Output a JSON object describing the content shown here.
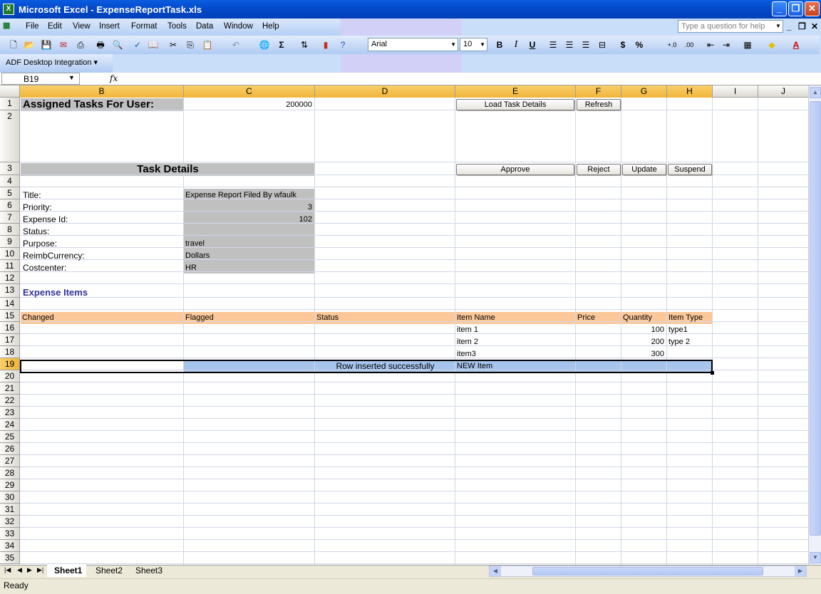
{
  "window": {
    "title": "Microsoft Excel - ExpenseReportTask.xls"
  },
  "menu": {
    "items": [
      {
        "key": "F",
        "rest": "ile"
      },
      {
        "key": "E",
        "rest": "dit"
      },
      {
        "key": "V",
        "rest": "iew"
      },
      {
        "key": "I",
        "rest": "nsert"
      },
      {
        "key": "F",
        "rest": "ormat",
        "pre": ""
      },
      {
        "key": "T",
        "rest": "ools"
      },
      {
        "key": "D",
        "rest": "ata"
      },
      {
        "key": "W",
        "rest": "indow"
      },
      {
        "key": "H",
        "rest": "elp"
      }
    ],
    "labels": [
      "File",
      "Edit",
      "View",
      "Insert",
      "Format",
      "Tools",
      "Data",
      "Window",
      "Help"
    ],
    "help_placeholder": "Type a question for help"
  },
  "toolbar": {
    "font": "Arial",
    "font_size": "10",
    "bold": "B",
    "italic": "I",
    "underline": "U",
    "currency": "$",
    "percent": "%",
    "sigma": "Σ",
    "adf_menu": "ADF Desktop Integration"
  },
  "formula_bar": {
    "name_box": "B19",
    "fx": "fx",
    "content": ""
  },
  "columns": [
    "B",
    "C",
    "D",
    "E",
    "F",
    "G",
    "H",
    "I",
    "J"
  ],
  "rows": [
    "1",
    "2",
    "3",
    "4",
    "5",
    "6",
    "7",
    "8",
    "9",
    "10",
    "11",
    "12",
    "13",
    "14",
    "15",
    "16",
    "17",
    "18",
    "19",
    "20",
    "21",
    "22",
    "23",
    "24",
    "25",
    "26",
    "27",
    "28",
    "29",
    "30",
    "31",
    "32",
    "33",
    "34",
    "35"
  ],
  "sheet": {
    "assigned_label": "Assigned Tasks For User:",
    "assigned_value": "200000",
    "task_details_header": "Task Details",
    "buttons": {
      "load": "Load Task Details",
      "refresh": "Refresh",
      "approve": "Approve",
      "reject": "Reject",
      "update": "Update",
      "suspend": "Suspend"
    },
    "fields": [
      {
        "label": "Title:",
        "value": "Expense Report Filed By wfaulk"
      },
      {
        "label": "Priority:",
        "value": "3"
      },
      {
        "label": "Expense Id:",
        "value": "102"
      },
      {
        "label": "Status:",
        "value": ""
      },
      {
        "label": "Purpose:",
        "value": "travel"
      },
      {
        "label": "ReimbCurrency:",
        "value": "Dollars"
      },
      {
        "label": "Costcenter:",
        "value": "HR"
      }
    ],
    "expense_items_title": "Expense Items",
    "table_headers": {
      "changed": "Changed",
      "flagged": "Flagged",
      "status": "Status",
      "item_name": "Item Name",
      "price": "Price",
      "quantity": "Quantity",
      "item_type": "Item Type"
    },
    "items": [
      {
        "name": "item 1",
        "quantity": "100",
        "type": "type1"
      },
      {
        "name": "item 2",
        "quantity": "200",
        "type": "type 2"
      },
      {
        "name": "item3",
        "quantity": "300",
        "type": ""
      }
    ],
    "new_row": {
      "status": "Row inserted successfully",
      "name": "NEW Item"
    }
  },
  "tabs": [
    "Sheet1",
    "Sheet2",
    "Sheet3"
  ],
  "status": {
    "text": "Ready"
  },
  "colors": {
    "title_blue": "#0348c8",
    "section_header": "#c0c0c0",
    "table_header": "#fcc89a",
    "new_row": "#a6c4ec",
    "expense_items_text": "#333399"
  }
}
